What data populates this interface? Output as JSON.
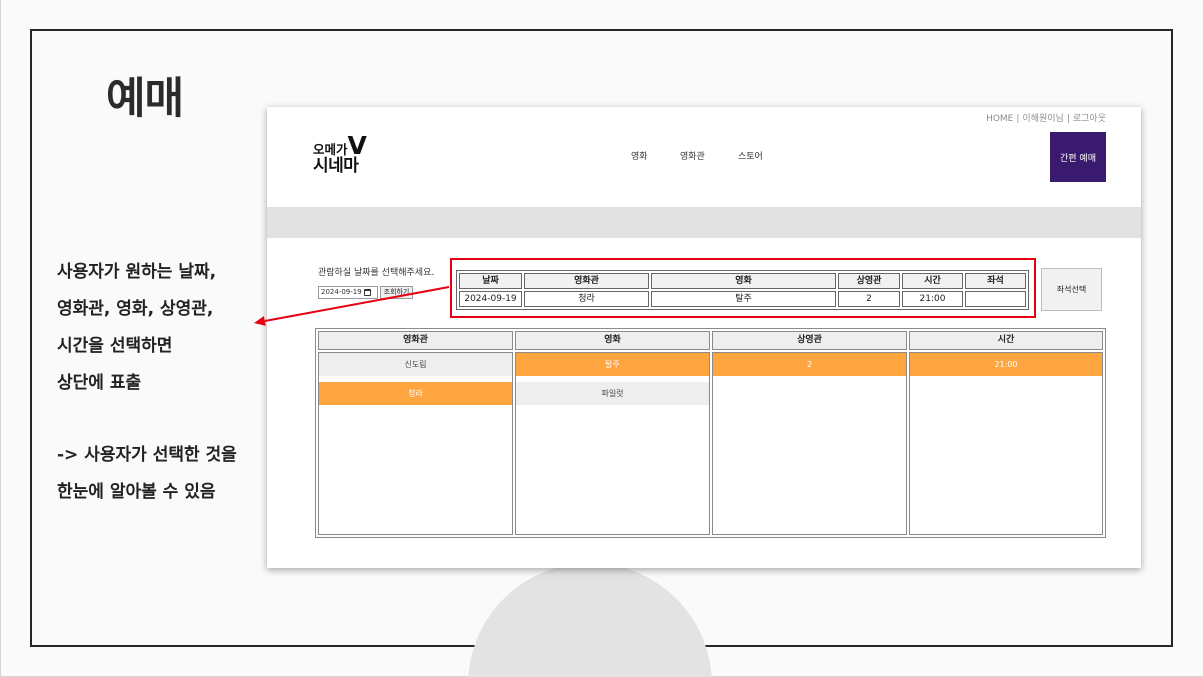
{
  "slide": {
    "title": "예매",
    "notes": {
      "lines_1": [
        "사용자가 원하는 날짜,",
        "영화관, 영화, 상영관,",
        "시간을 선택하면",
        "상단에 표출"
      ],
      "lines_2": [
        "-> 사용자가 선택한 것을",
        "한눈에 알아볼 수 있음"
      ]
    }
  },
  "site": {
    "top_links": {
      "home": "HOME",
      "user": "이해원이님",
      "logout": "로그아웃",
      "separator": "|"
    },
    "logo": {
      "small": "오메가",
      "mark": "V",
      "name": "시네마"
    },
    "nav": [
      "영화",
      "영화관",
      "스토어"
    ],
    "quick_booking": "간편 예매"
  },
  "booking": {
    "date_prompt": "관람하실 날짜를 선택해주세요.",
    "date_value": "2024-09-19",
    "date_icon": "calendar-icon",
    "lookup_button": "조회하기",
    "summary": {
      "headers": [
        "날짜",
        "영화관",
        "영화",
        "상영관",
        "시간",
        "좌석"
      ],
      "values": [
        "2024-09-19",
        "청라",
        "탈주",
        "2",
        "21:00",
        ""
      ]
    },
    "seat_button": "좌석선택",
    "selector": [
      {
        "header": "영화관",
        "items": [
          {
            "label": "신도림",
            "selected": false
          },
          {
            "label": "청라",
            "selected": true
          }
        ]
      },
      {
        "header": "영화",
        "items": [
          {
            "label": "탈주",
            "selected": true
          },
          {
            "label": "파일럿",
            "selected": false
          }
        ]
      },
      {
        "header": "상영관",
        "items": [
          {
            "label": "2",
            "selected": true
          }
        ]
      },
      {
        "header": "시간",
        "items": [
          {
            "label": "21:00",
            "selected": true
          }
        ]
      }
    ]
  },
  "colors": {
    "selected_item": "#ffa540",
    "quick_booking": "#3a1a6e",
    "highlight_box": "#e60012",
    "arrow": "#e60012"
  }
}
